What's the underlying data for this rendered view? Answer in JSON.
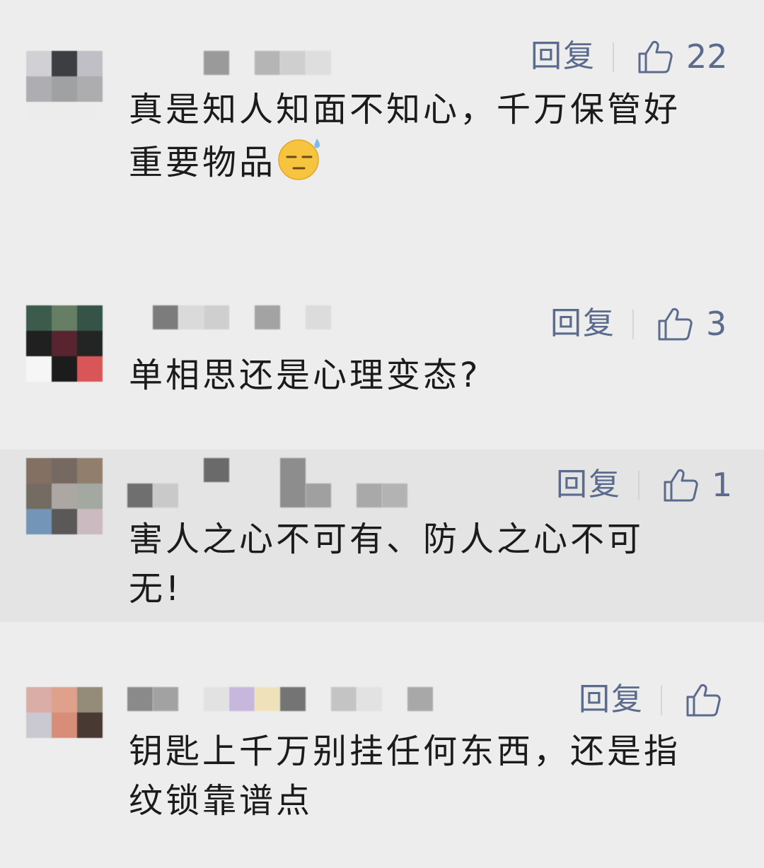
{
  "ui": {
    "reply_label": "回复",
    "accent": "#5a6b8e"
  },
  "comments": [
    {
      "text_line1": "真是知人知面不知心，千万保管好",
      "text_line2": "重要物品",
      "emoji": "sweat-smile-emoji",
      "likes": "22"
    },
    {
      "text_line1": "单相思还是心理变态?",
      "likes": "3"
    },
    {
      "text_line1": "害人之心不可有、防人之心不可",
      "text_line2": "无!",
      "likes": "1"
    },
    {
      "text_line1": "钥匙上千万别挂任何东西，还是指",
      "text_line2": "纹锁靠谱点",
      "likes": ""
    }
  ]
}
